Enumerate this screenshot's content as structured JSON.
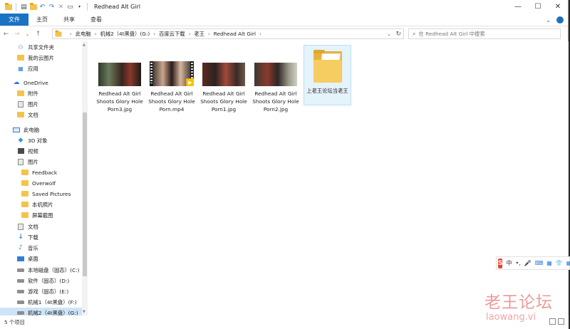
{
  "titlebar": {
    "title": "Redhead Alt Girl",
    "minimize": "—",
    "maximize": "☐",
    "close": "✕",
    "quick_access": [
      "folder",
      "properties",
      "new-folder",
      "undo",
      "redo",
      "delete",
      "rename"
    ]
  },
  "ribbon": {
    "tabs": [
      "文件",
      "主页",
      "共享",
      "查看"
    ],
    "expand": "⌄",
    "help": "?"
  },
  "navigation": {
    "back": "←",
    "forward": "→",
    "recent": "⌄",
    "up": "↑",
    "breadcrumb": [
      "此电脑",
      "机械2（4t黑盘）(G:)",
      "百度云下载",
      "老王",
      "Redhead Alt Girl"
    ],
    "dropdown": "⌄",
    "refresh": "↻"
  },
  "search": {
    "placeholder": "在 Redhead Alt Girl 中搜索",
    "icon": "search-icon"
  },
  "sidebar": {
    "items": [
      {
        "label": "共享文件夹",
        "icon": "shared-folder-icon"
      },
      {
        "label": "我的云图片",
        "icon": "folder-icon"
      },
      {
        "label": "应用",
        "icon": "apps-icon"
      },
      {
        "label": "OneDrive",
        "icon": "cloud-icon"
      },
      {
        "label": "附件",
        "icon": "folder-icon"
      },
      {
        "label": "图片",
        "icon": "pictures-icon"
      },
      {
        "label": "文档",
        "icon": "folder-icon"
      },
      {
        "label": "此电脑",
        "icon": "pc-icon"
      },
      {
        "label": "3D 对象",
        "icon": "3d-objects-icon"
      },
      {
        "label": "视频",
        "icon": "video-icon"
      },
      {
        "label": "图片",
        "icon": "pictures-icon"
      },
      {
        "label": "Feedback",
        "icon": "folder-icon"
      },
      {
        "label": "Overwolf",
        "icon": "folder-icon"
      },
      {
        "label": "Saved Pictures",
        "icon": "folder-icon"
      },
      {
        "label": "本机照片",
        "icon": "folder-icon"
      },
      {
        "label": "屏幕截图",
        "icon": "folder-icon"
      },
      {
        "label": "文档",
        "icon": "documents-icon"
      },
      {
        "label": "下载",
        "icon": "download-icon"
      },
      {
        "label": "音乐",
        "icon": "music-icon"
      },
      {
        "label": "桌面",
        "icon": "desktop-icon"
      },
      {
        "label": "本地磁盘（固态）(C:)",
        "icon": "drive-icon"
      },
      {
        "label": "软件（固态）(D:)",
        "icon": "drive-icon"
      },
      {
        "label": "游戏（固态）(E:)",
        "icon": "drive-icon"
      },
      {
        "label": "机械1（4t黑盘）(F:)",
        "icon": "drive-icon"
      },
      {
        "label": "机械2（4t黑盘）(G:)",
        "icon": "drive-icon"
      }
    ]
  },
  "files": [
    {
      "name": "Redhead Alt Girl Shoots Glory Hole Porn3.jpg",
      "type": "image"
    },
    {
      "name": "Redhead Alt Girl Shoots Glory Hole Porn.mp4",
      "type": "video"
    },
    {
      "name": "Redhead Alt Girl Shoots Glory Hole Porn1.jpg",
      "type": "image"
    },
    {
      "name": "Redhead Alt Girl Shoots Glory Hole Porn2.jpg",
      "type": "image"
    },
    {
      "name": "上老王论坛当老王",
      "type": "folder"
    }
  ],
  "statusbar": {
    "count": "5 个项目"
  },
  "ime": {
    "logo": "S",
    "lang": "中",
    "punct": "•,",
    "mic": "🎤",
    "keyboard": "⌨",
    "grid": "▦",
    "skin": "👕",
    "tools": "▦"
  },
  "watermark": {
    "line1": "老王论坛",
    "line2": "laowang.vi"
  },
  "colors": {
    "accent": "#1a72c4",
    "selection": "#cde3f7",
    "folder": "#f4c24d",
    "ime_red": "#e8432e",
    "watermark": "#e04a4a"
  }
}
